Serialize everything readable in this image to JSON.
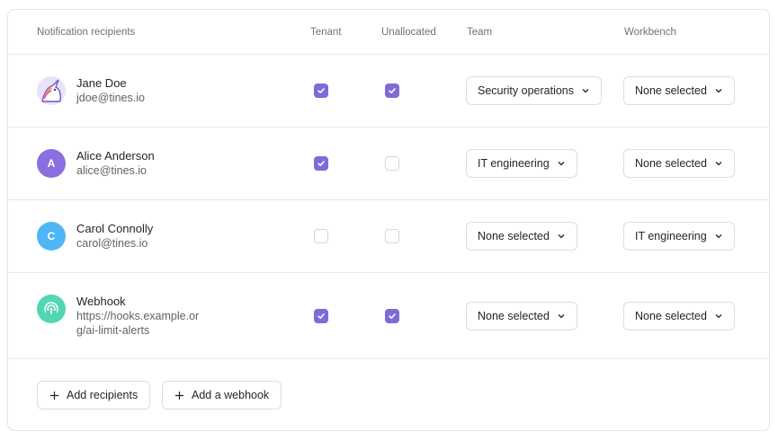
{
  "columns": {
    "recipients": "Notification recipients",
    "tenant": "Tenant",
    "unallocated": "Unallocated",
    "team": "Team",
    "workbench": "Workbench"
  },
  "colors": {
    "checkbox_checked": "#7f6ad8",
    "avatar_alice": "#8a6fe0",
    "avatar_carol": "#4fb6f5",
    "avatar_webhook": "#52d6b4"
  },
  "rows": [
    {
      "name": "Jane Doe",
      "detail": [
        "jdoe@tines.io"
      ],
      "avatar_icon": "unicorn-avatar-icon",
      "tenant": true,
      "unallocated": true,
      "team": "Security operations",
      "workbench": "None selected"
    },
    {
      "name": "Alice Anderson",
      "detail": [
        "alice@tines.io"
      ],
      "avatar_initial": "A",
      "tenant": true,
      "unallocated": false,
      "team": "IT engineering",
      "workbench": "None selected"
    },
    {
      "name": "Carol Connolly",
      "detail": [
        "carol@tines.io"
      ],
      "avatar_initial": "C",
      "tenant": false,
      "unallocated": false,
      "team": "None selected",
      "workbench": "IT engineering"
    },
    {
      "name": "Webhook",
      "detail": [
        "https://hooks.example.or",
        "g/ai-limit-alerts"
      ],
      "avatar_icon": "webhook-icon",
      "tenant": true,
      "unallocated": true,
      "team": "None selected",
      "workbench": "None selected"
    }
  ],
  "actions": {
    "add_recipients": "Add recipients",
    "add_webhook": "Add a webhook"
  }
}
